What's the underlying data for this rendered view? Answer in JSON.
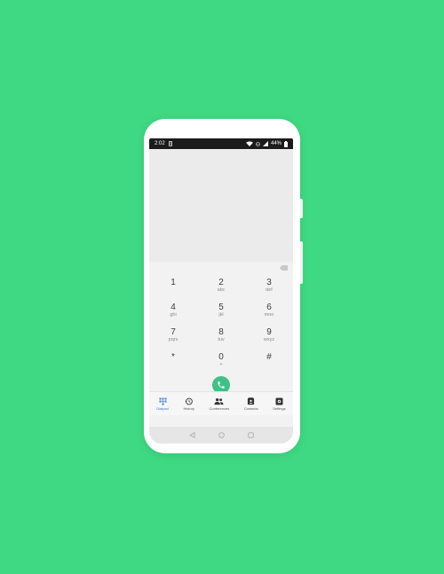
{
  "status_bar": {
    "time": "2:02",
    "battery": "44%"
  },
  "dialpad": {
    "keys": [
      {
        "digit": "1",
        "letters": ""
      },
      {
        "digit": "2",
        "letters": "abc"
      },
      {
        "digit": "3",
        "letters": "def"
      },
      {
        "digit": "4",
        "letters": "ghi"
      },
      {
        "digit": "5",
        "letters": "jkl"
      },
      {
        "digit": "6",
        "letters": "mno"
      },
      {
        "digit": "7",
        "letters": "pqrs"
      },
      {
        "digit": "8",
        "letters": "tuv"
      },
      {
        "digit": "9",
        "letters": "wxyz"
      },
      {
        "digit": "*",
        "letters": ""
      },
      {
        "digit": "0",
        "letters": "+"
      },
      {
        "digit": "#",
        "letters": ""
      }
    ]
  },
  "bottom_nav": {
    "items": [
      {
        "label": "Dialpad",
        "icon": "dialpad-icon",
        "active": true
      },
      {
        "label": "History",
        "icon": "history-icon",
        "active": false
      },
      {
        "label": "Conferences",
        "icon": "group-icon",
        "active": false
      },
      {
        "label": "Contacts",
        "icon": "contacts-icon",
        "active": false
      },
      {
        "label": "Settings",
        "icon": "settings-icon",
        "active": false
      }
    ]
  },
  "colors": {
    "background": "#3fd983",
    "call_button": "#3ec187",
    "active_tab": "#3a7bd5"
  }
}
